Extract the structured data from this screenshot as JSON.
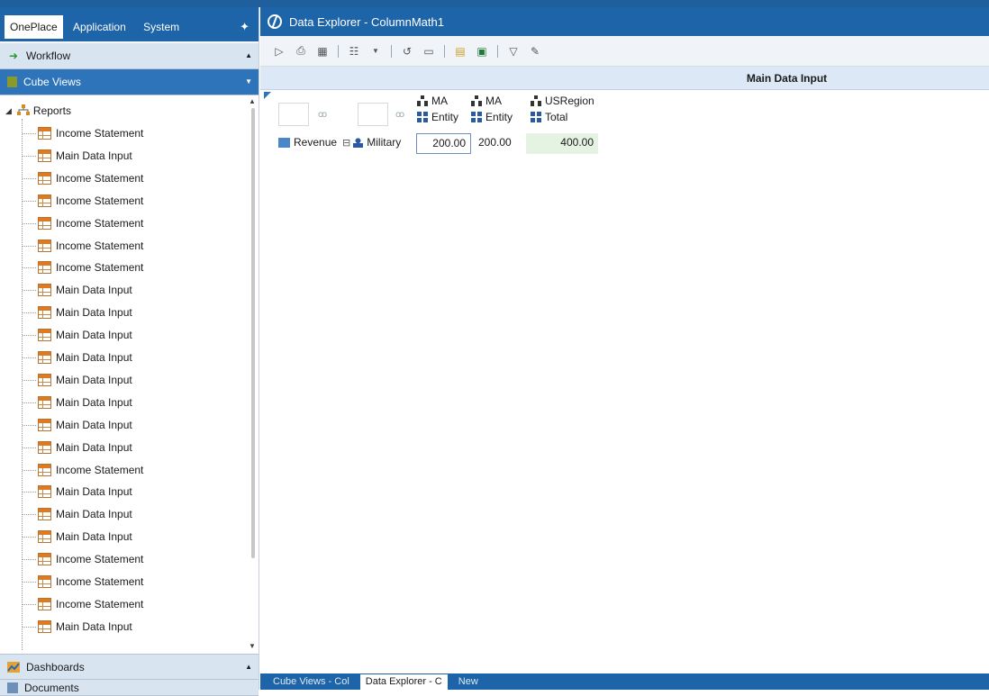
{
  "left_panel": {
    "tabs": [
      "OnePlace",
      "Application",
      "System"
    ],
    "workflow_label": "Workflow",
    "cube_views_label": "Cube Views",
    "tree_root": "Reports",
    "tree_items": [
      "Income Statement",
      "Main Data Input",
      "Income Statement",
      "Income Statement",
      "Income Statement",
      "Income Statement",
      "Income Statement",
      "Main Data Input",
      "Main Data Input",
      "Main Data Input",
      "Main Data Input",
      "Main Data Input",
      "Main Data Input",
      "Main Data Input",
      "Main Data Input",
      "Income Statement",
      "Main Data Input",
      "Main Data Input",
      "Main Data Input",
      "Income Statement",
      "Income Statement",
      "Income Statement",
      "Main Data Input"
    ],
    "dashboards_label": "Dashboards",
    "documents_label": "Documents"
  },
  "window": {
    "title": "Data Explorer - ColumnMath1"
  },
  "grid": {
    "header_title": "Main Data Input",
    "columns": [
      {
        "entity": "MA",
        "member": "Entity"
      },
      {
        "entity": "MA",
        "member": "Entity"
      },
      {
        "entity": "USRegion",
        "member": "Total"
      }
    ],
    "row": {
      "account": "Revenue",
      "member": "Military"
    },
    "values": [
      "200.00",
      "200.00",
      "400.00"
    ]
  },
  "bottom_tabs": [
    "Cube Views - Col",
    "Data Explorer - C",
    "New"
  ]
}
